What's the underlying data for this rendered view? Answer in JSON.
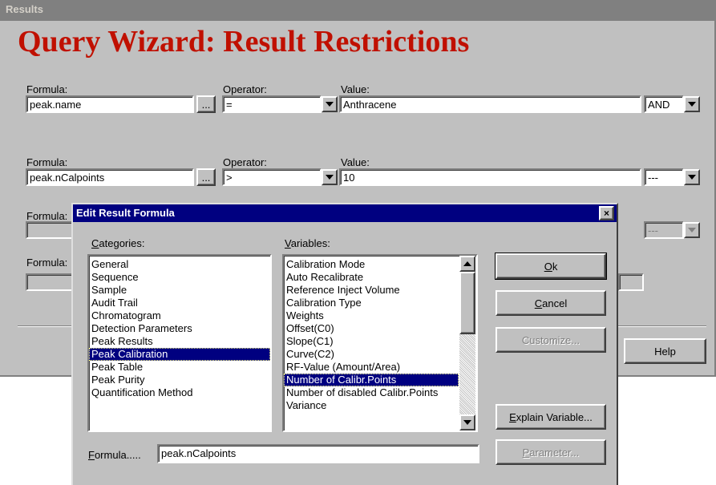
{
  "window": {
    "title": "Results",
    "heading": "Query Wizard: Result Restrictions"
  },
  "rows": [
    {
      "formula_label": "Formula:",
      "formula": "peak.name",
      "browse": "...",
      "operator_label": "Operator:",
      "operator": "=",
      "value_label": "Value:",
      "value": "Anthracene",
      "logic": "AND"
    },
    {
      "formula_label": "Formula:",
      "formula": "peak.nCalpoints",
      "browse": "...",
      "operator_label": "Operator:",
      "operator": ">",
      "value_label": "Value:",
      "value": "10",
      "logic": "---"
    },
    {
      "formula_label": "Formula:",
      "logic": "---"
    },
    {
      "formula_label": "Formula:"
    }
  ],
  "help_label": "Help",
  "dialog": {
    "title": "Edit Result Formula",
    "close": "×",
    "categories_label": "Categories:",
    "categories": [
      "General",
      "Sequence",
      "Sample",
      "Audit Trail",
      "Chromatogram",
      "Detection Parameters",
      "Peak Results",
      "Peak Calibration",
      "Peak Table",
      "Peak Purity",
      "Quantification Method"
    ],
    "categories_selected": "Peak Calibration",
    "variables_label": "Variables:",
    "variables": [
      "Calibration Mode",
      "Auto Recalibrate",
      "Reference Inject Volume",
      "Calibration Type",
      "Weights",
      "Offset(C0)",
      "Slope(C1)",
      "Curve(C2)",
      "RF-Value (Amount/Area)",
      "Number of Calibr.Points",
      "Number of disabled Calibr.Points",
      "Variance"
    ],
    "variables_selected": "Number of Calibr.Points",
    "ok": "Ok",
    "cancel": "Cancel",
    "customize": "Customize...",
    "explain": "Explain Variable...",
    "parameter": "Parameter...",
    "formula_label": "Formula.....",
    "formula_value": "peak.nCalpoints"
  }
}
